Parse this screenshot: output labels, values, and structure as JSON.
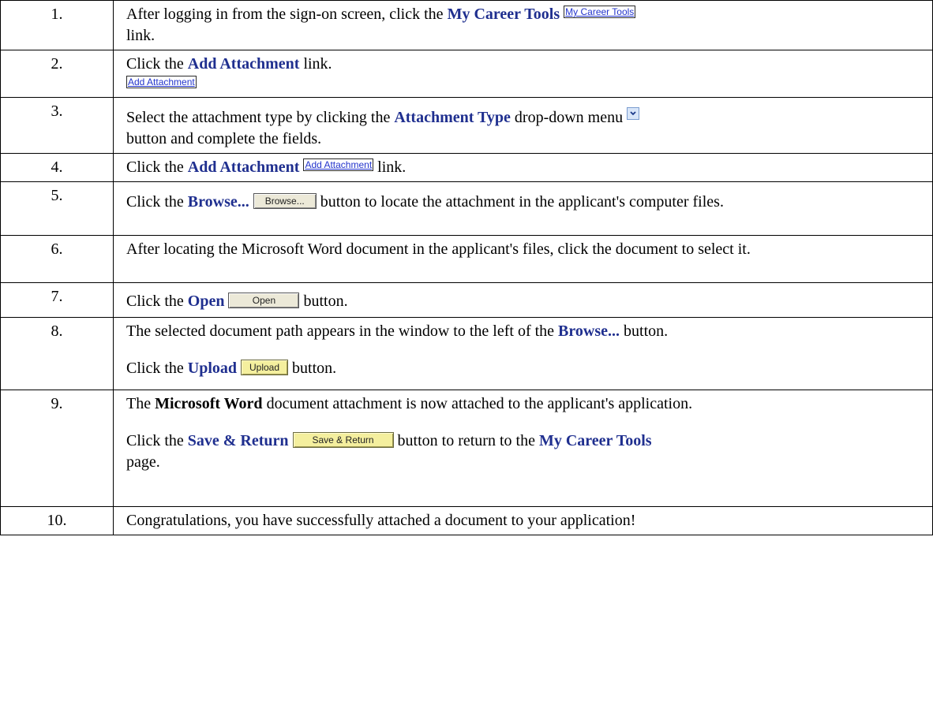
{
  "steps": [
    {
      "num": "1.",
      "t1": "After logging in from the sign-on screen, click the ",
      "b1": "My Career Tools",
      "img1": "My Career Tools",
      "t2": "link."
    },
    {
      "num": "2.",
      "t1": "Click the ",
      "b1": "Add Attachment",
      "t2": " link.",
      "img1": "Add Attachment"
    },
    {
      "num": "3.",
      "t1": "Select the attachment type by clicking the ",
      "b1": "Attachment Type",
      "t2": " drop-down menu ",
      "t3": "button and complete the fields."
    },
    {
      "num": "4.",
      "t1": "Click the ",
      "b1": "Add Attachment",
      "img1": "Add Attachment",
      "t2": " link."
    },
    {
      "num": "5.",
      "t1": "Click the ",
      "b1": "Browse...",
      "img1": "Browse...",
      "t2": " button to locate the attachment in the applicant's computer files."
    },
    {
      "num": "6.",
      "t1": "After locating the Microsoft Word document in the applicant's files, click the document to select it."
    },
    {
      "num": "7.",
      "t1": "Click the ",
      "b1": "Open",
      "img1": "Open",
      "t2": " button."
    },
    {
      "num": "8.",
      "t1": "The selected document path appears in the window to the left of the ",
      "b1": "Browse...",
      "t2": " button.",
      "t3": "Click the ",
      "b2": "Upload",
      "img1": "Upload",
      "t4": " button."
    },
    {
      "num": "9.",
      "t1": "The ",
      "b1": "Microsoft Word",
      "t2": " document attachment is now attached to the applicant's application.",
      "t3": "Click the ",
      "b2": "Save & Return",
      "img1": "Save & Return",
      "t4": " button to return to the ",
      "b3": "My Career Tools",
      "t5": " page."
    },
    {
      "num": "10.",
      "t1": "Congratulations, you have successfully attached a document to your application!"
    }
  ],
  "icons": {
    "dropdown": "chevron-down-icon"
  }
}
